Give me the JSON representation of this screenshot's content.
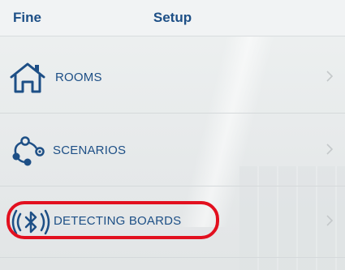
{
  "nav": {
    "back_label": "Fine",
    "title": "Setup"
  },
  "menu": {
    "items": [
      {
        "label": "ROOMS",
        "icon": "house-icon"
      },
      {
        "label": "SCENARIOS",
        "icon": "scenarios-icon"
      },
      {
        "label": "DETECTING BOARDS",
        "icon": "bluetooth-icon"
      }
    ]
  },
  "colors": {
    "accent": "#1d4f86",
    "highlight": "#e2101f",
    "chevron": "#c4c8ca"
  }
}
